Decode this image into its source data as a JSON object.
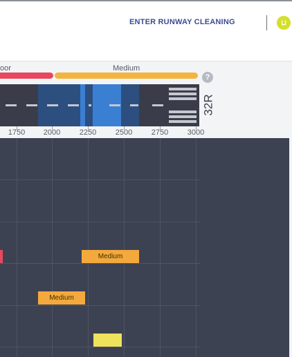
{
  "topbar": {
    "enter_runway_cleaning": "ENTER RUNWAY CLEANING",
    "avatar_glyph": "⊔"
  },
  "friction": {
    "poor_label": "oor",
    "medium_label": "Medium",
    "poor_color": "#e8485e",
    "medium_color": "#f4b440"
  },
  "help_label": "?",
  "runway": {
    "id": "32R",
    "axis_labels": [
      "1750",
      "2000",
      "2250",
      "2500",
      "2750",
      "3000"
    ]
  },
  "colors": {
    "grid_bg": "#3d4252",
    "block_medium": "#f4a93d",
    "block_poor": "#e8485e",
    "block_good": "#f0e35c"
  },
  "blocks": [
    {
      "label": "Medium"
    },
    {
      "label": "Medium"
    },
    {
      "label": ""
    },
    {
      "label": ""
    }
  ]
}
